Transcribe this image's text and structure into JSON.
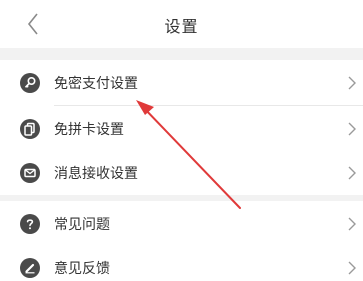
{
  "header": {
    "title": "设置"
  },
  "group1": [
    {
      "label": "免密支付设置",
      "icon": "key-icon"
    },
    {
      "label": "免拼卡设置",
      "icon": "card-icon"
    },
    {
      "label": "消息接收设置",
      "icon": "envelope-icon"
    }
  ],
  "group2": [
    {
      "label": "常见问题",
      "icon": "question-icon"
    },
    {
      "label": "意见反馈",
      "icon": "pencil-icon"
    }
  ],
  "colors": {
    "icon_bg": "#4a4a4a",
    "separator": "#f2f2f2",
    "annotation_arrow": "#e03a3a"
  }
}
